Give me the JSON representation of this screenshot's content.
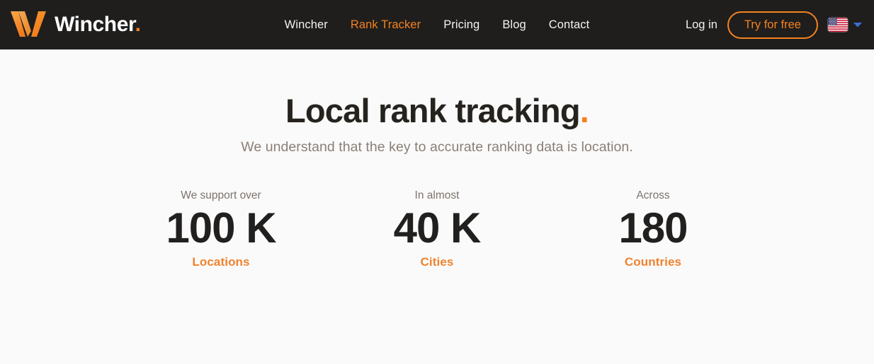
{
  "brand": {
    "logo_icon": "wincher-w-logo",
    "wordmark": "Wincher",
    "wordmark_dot": "."
  },
  "nav": {
    "items": [
      {
        "label": "Wincher",
        "active": false
      },
      {
        "label": "Rank Tracker",
        "active": true
      },
      {
        "label": "Pricing",
        "active": false
      },
      {
        "label": "Blog",
        "active": false
      },
      {
        "label": "Contact",
        "active": false
      }
    ]
  },
  "header_actions": {
    "login_label": "Log in",
    "cta_label": "Try for free",
    "language": {
      "flag_icon": "us-flag-icon",
      "chevron_icon": "chevron-down-icon"
    }
  },
  "hero": {
    "title": "Local rank tracking",
    "title_dot": ".",
    "subtitle": "We understand that the key to accurate ranking data is location."
  },
  "stats": [
    {
      "label": "We support over",
      "value": "100 K",
      "caption": "Locations"
    },
    {
      "label": "In almost",
      "value": "40 K",
      "caption": "Cities"
    },
    {
      "label": "Across",
      "value": "180",
      "caption": "Countries"
    }
  ],
  "colors": {
    "accent_orange": "#f5821f",
    "header_background": "#1f1e1d",
    "page_background": "#fafafa",
    "heading_text": "#26231f",
    "muted_text": "#8a7f77"
  }
}
